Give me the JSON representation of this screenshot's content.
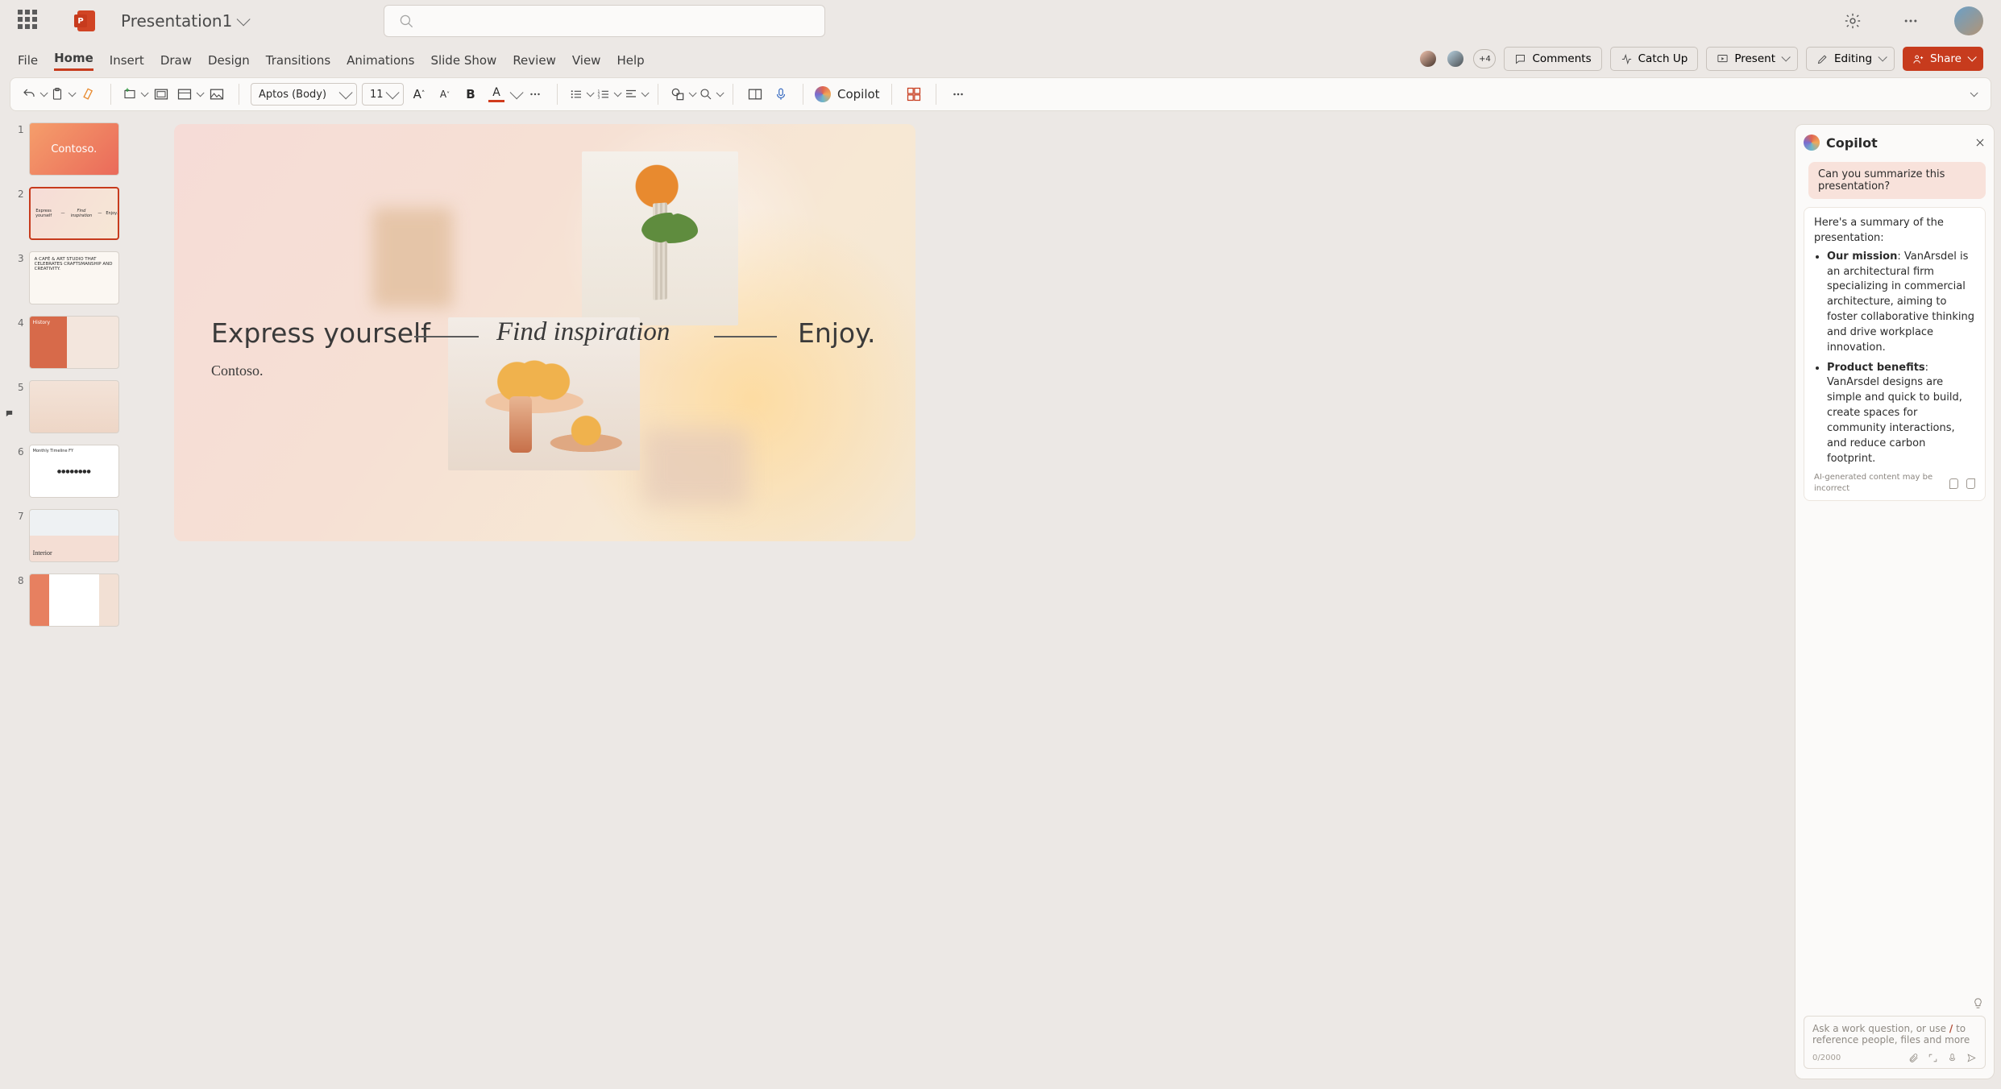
{
  "app": {
    "initial": "P",
    "doc_title": "Presentation1"
  },
  "menu": {
    "items": [
      "File",
      "Home",
      "Insert",
      "Draw",
      "Design",
      "Transitions",
      "Animations",
      "Slide Show",
      "Review",
      "View",
      "Help"
    ],
    "active_index": 1
  },
  "collab": {
    "extra_count": "+4",
    "comments": "Comments",
    "catchup": "Catch Up",
    "present": "Present",
    "editing": "Editing",
    "share": "Share"
  },
  "ribbon": {
    "font_name": "Aptos (Body)",
    "font_size": "11",
    "copilot": "Copilot"
  },
  "thumbs": {
    "count": 8,
    "selected": 2,
    "has_comment_on": 5,
    "slide1_title": "Contoso.",
    "slide3_text": "A CAFÉ & ART STUDIO THAT CELEBRATES CRAFTSMANSHIP AND CREATIVITY.",
    "slide4_title": "History",
    "slide6_title": "Monthly Timeline FY",
    "slide7_title": "Interior"
  },
  "slide": {
    "h1": "Express yourself",
    "h2": "Find inspiration",
    "h3": "Enjoy.",
    "brand": "Contoso."
  },
  "copilot": {
    "title": "Copilot",
    "user_msg": "Can you summarize this presentation?",
    "ai_intro": "Here's a summary of the presentation:",
    "bullets": [
      {
        "lead": "Our mission",
        "text": ": VanArsdel is an architectural firm specializing in commercial architecture, aiming to foster collaborative thinking and drive workplace innovation."
      },
      {
        "lead": "Product benefits",
        "text": ": VanArsdel designs are simple and quick to build, create spaces for community interactions, and reduce carbon footprint."
      }
    ],
    "disclaimer": "AI-generated content may be incorrect",
    "prompt_hint_a": "Ask a work question, or use ",
    "prompt_slash": "/",
    "prompt_hint_b": " to reference people, files and more",
    "char_count": "0/2000"
  }
}
